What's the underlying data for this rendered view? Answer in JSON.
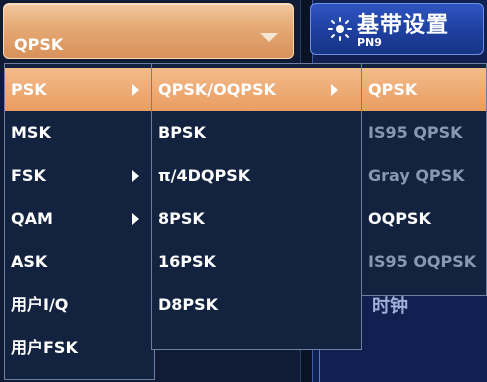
{
  "selector": {
    "value": "QPSK",
    "color": "#e6a873"
  },
  "baseband_button": {
    "title": "基带设置",
    "subtitle": "PN9",
    "icon": "sun-icon",
    "color": "#1e3f9e"
  },
  "hidden_label": "时钟",
  "menus": {
    "level1": {
      "items": [
        {
          "label": "PSK",
          "has_submenu": true,
          "active": true
        },
        {
          "label": "MSK",
          "has_submenu": false
        },
        {
          "label": "FSK",
          "has_submenu": true
        },
        {
          "label": "QAM",
          "has_submenu": true
        },
        {
          "label": "ASK",
          "has_submenu": false
        },
        {
          "label": "用户I/Q",
          "has_submenu": false
        },
        {
          "label": "用户FSK",
          "has_submenu": false
        }
      ]
    },
    "level2": {
      "items": [
        {
          "label": "QPSK/OQPSK",
          "has_submenu": true,
          "active": true
        },
        {
          "label": "BPSK",
          "has_submenu": false
        },
        {
          "label": "π/4DQPSK",
          "has_submenu": false
        },
        {
          "label": "8PSK",
          "has_submenu": false
        },
        {
          "label": "16PSK",
          "has_submenu": false
        },
        {
          "label": "D8PSK",
          "has_submenu": false
        }
      ]
    },
    "level3": {
      "items": [
        {
          "label": "QPSK",
          "active": true,
          "enabled": true
        },
        {
          "label": "IS95 QPSK",
          "enabled": false
        },
        {
          "label": "Gray QPSK",
          "enabled": false
        },
        {
          "label": "OQPSK",
          "enabled": true
        },
        {
          "label": "IS95 OQPSK",
          "enabled": false
        }
      ]
    }
  },
  "colors": {
    "highlight": "#e99d62",
    "menu_bg": "#13223f",
    "disabled_text": "#8a97b0"
  }
}
